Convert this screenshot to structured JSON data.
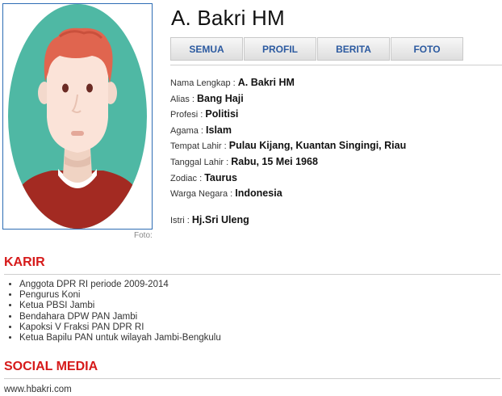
{
  "profile": {
    "name": "A. Bakri HM",
    "photo_caption": "Foto:"
  },
  "tabs": [
    {
      "label": "SEMUA"
    },
    {
      "label": "PROFIL"
    },
    {
      "label": "BERITA"
    },
    {
      "label": "FOTO"
    }
  ],
  "bio": [
    {
      "label": "Nama Lengkap : ",
      "value": "A. Bakri HM"
    },
    {
      "label": "Alias : ",
      "value": "Bang Haji"
    },
    {
      "label": "Profesi : ",
      "value": "Politisi"
    },
    {
      "label": "Agama : ",
      "value": "Islam"
    },
    {
      "label": "Tempat Lahir : ",
      "value": "Pulau Kijang, Kuantan Singingi, Riau"
    },
    {
      "label": "Tanggal Lahir : ",
      "value": "Rabu, 15 Mei 1968"
    },
    {
      "label": "Zodiac : ",
      "value": "Taurus"
    },
    {
      "label": "Warga Negara : ",
      "value": "Indonesia"
    }
  ],
  "spouse": {
    "label": "Istri : ",
    "value": "Hj.Sri Uleng"
  },
  "career": {
    "title": "KARIR",
    "items": [
      "Anggota DPR RI periode 2009-2014",
      "Pengurus Koni",
      "Ketua PBSI Jambi",
      "Bendahara DPW PAN Jambi",
      "Kapoksi V Fraksi PAN DPR RI",
      "Ketua Bapilu PAN untuk wilayah Jambi-Bengkulu"
    ]
  },
  "social": {
    "title": "SOCIAL MEDIA",
    "website": "www.hbakri.com"
  },
  "colors": {
    "accent_red": "#d61a1a",
    "tab_text": "#2c5aa0",
    "avatar_bg": "#4fb8a4",
    "avatar_hair": "#e0654f",
    "avatar_shirt": "#a32a22"
  }
}
